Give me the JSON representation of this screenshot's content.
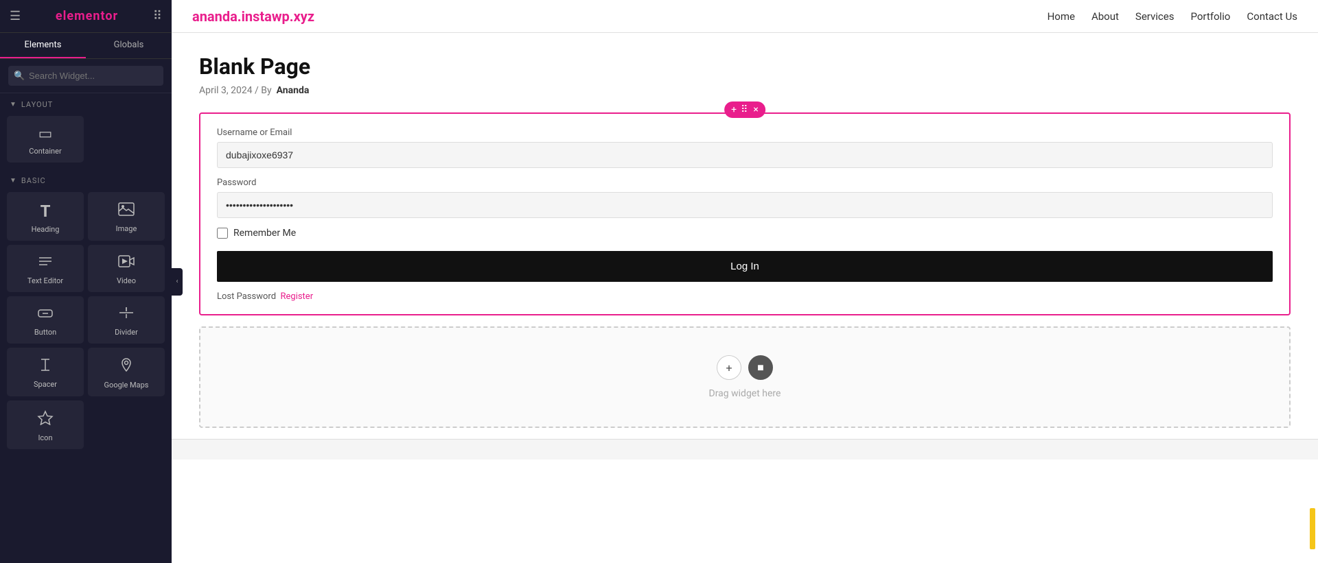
{
  "sidebar": {
    "brand": "elementor",
    "tabs": [
      {
        "id": "elements",
        "label": "Elements"
      },
      {
        "id": "globals",
        "label": "Globals"
      }
    ],
    "active_tab": "elements",
    "search_placeholder": "Search Widget...",
    "sections": [
      {
        "id": "layout",
        "label": "Layout",
        "widgets": [
          {
            "id": "container",
            "label": "Container",
            "icon": "▭"
          }
        ]
      },
      {
        "id": "basic",
        "label": "Basic",
        "widgets": [
          {
            "id": "heading",
            "label": "Heading",
            "icon": "T"
          },
          {
            "id": "image",
            "label": "Image",
            "icon": "🖼"
          },
          {
            "id": "text-editor",
            "label": "Text Editor",
            "icon": "≡"
          },
          {
            "id": "video",
            "label": "Video",
            "icon": "▶"
          },
          {
            "id": "button",
            "label": "Button",
            "icon": "⊡"
          },
          {
            "id": "divider",
            "label": "Divider",
            "icon": "⇕"
          },
          {
            "id": "spacer",
            "label": "Spacer",
            "icon": "↕"
          },
          {
            "id": "google-maps",
            "label": "Google Maps",
            "icon": "📍"
          },
          {
            "id": "icon",
            "label": "Icon",
            "icon": "☆"
          }
        ]
      }
    ]
  },
  "topnav": {
    "site_url": "ananda.instawp.xyz",
    "links": [
      {
        "id": "home",
        "label": "Home"
      },
      {
        "id": "about",
        "label": "About"
      },
      {
        "id": "services",
        "label": "Services"
      },
      {
        "id": "portfolio",
        "label": "Portfolio"
      },
      {
        "id": "contact",
        "label": "Contact Us"
      }
    ]
  },
  "page": {
    "title": "Blank Page",
    "meta": "April 3, 2024  /  By",
    "author": "Ananda"
  },
  "login_widget": {
    "toolbar": {
      "add_btn": "+",
      "drag_btn": "⠿",
      "close_btn": "×"
    },
    "username_label": "Username or Email",
    "username_value": "dubajixoxe6937",
    "password_label": "Password",
    "password_value": "••••••••••••••••••••",
    "remember_label": "Remember Me",
    "login_btn_label": "Log In",
    "lost_password_text": "Lost Password",
    "register_link": "Register"
  },
  "drop_zone": {
    "add_btn": "+",
    "template_btn": "■",
    "drag_text": "Drag widget here"
  },
  "collapse_btn": "‹"
}
